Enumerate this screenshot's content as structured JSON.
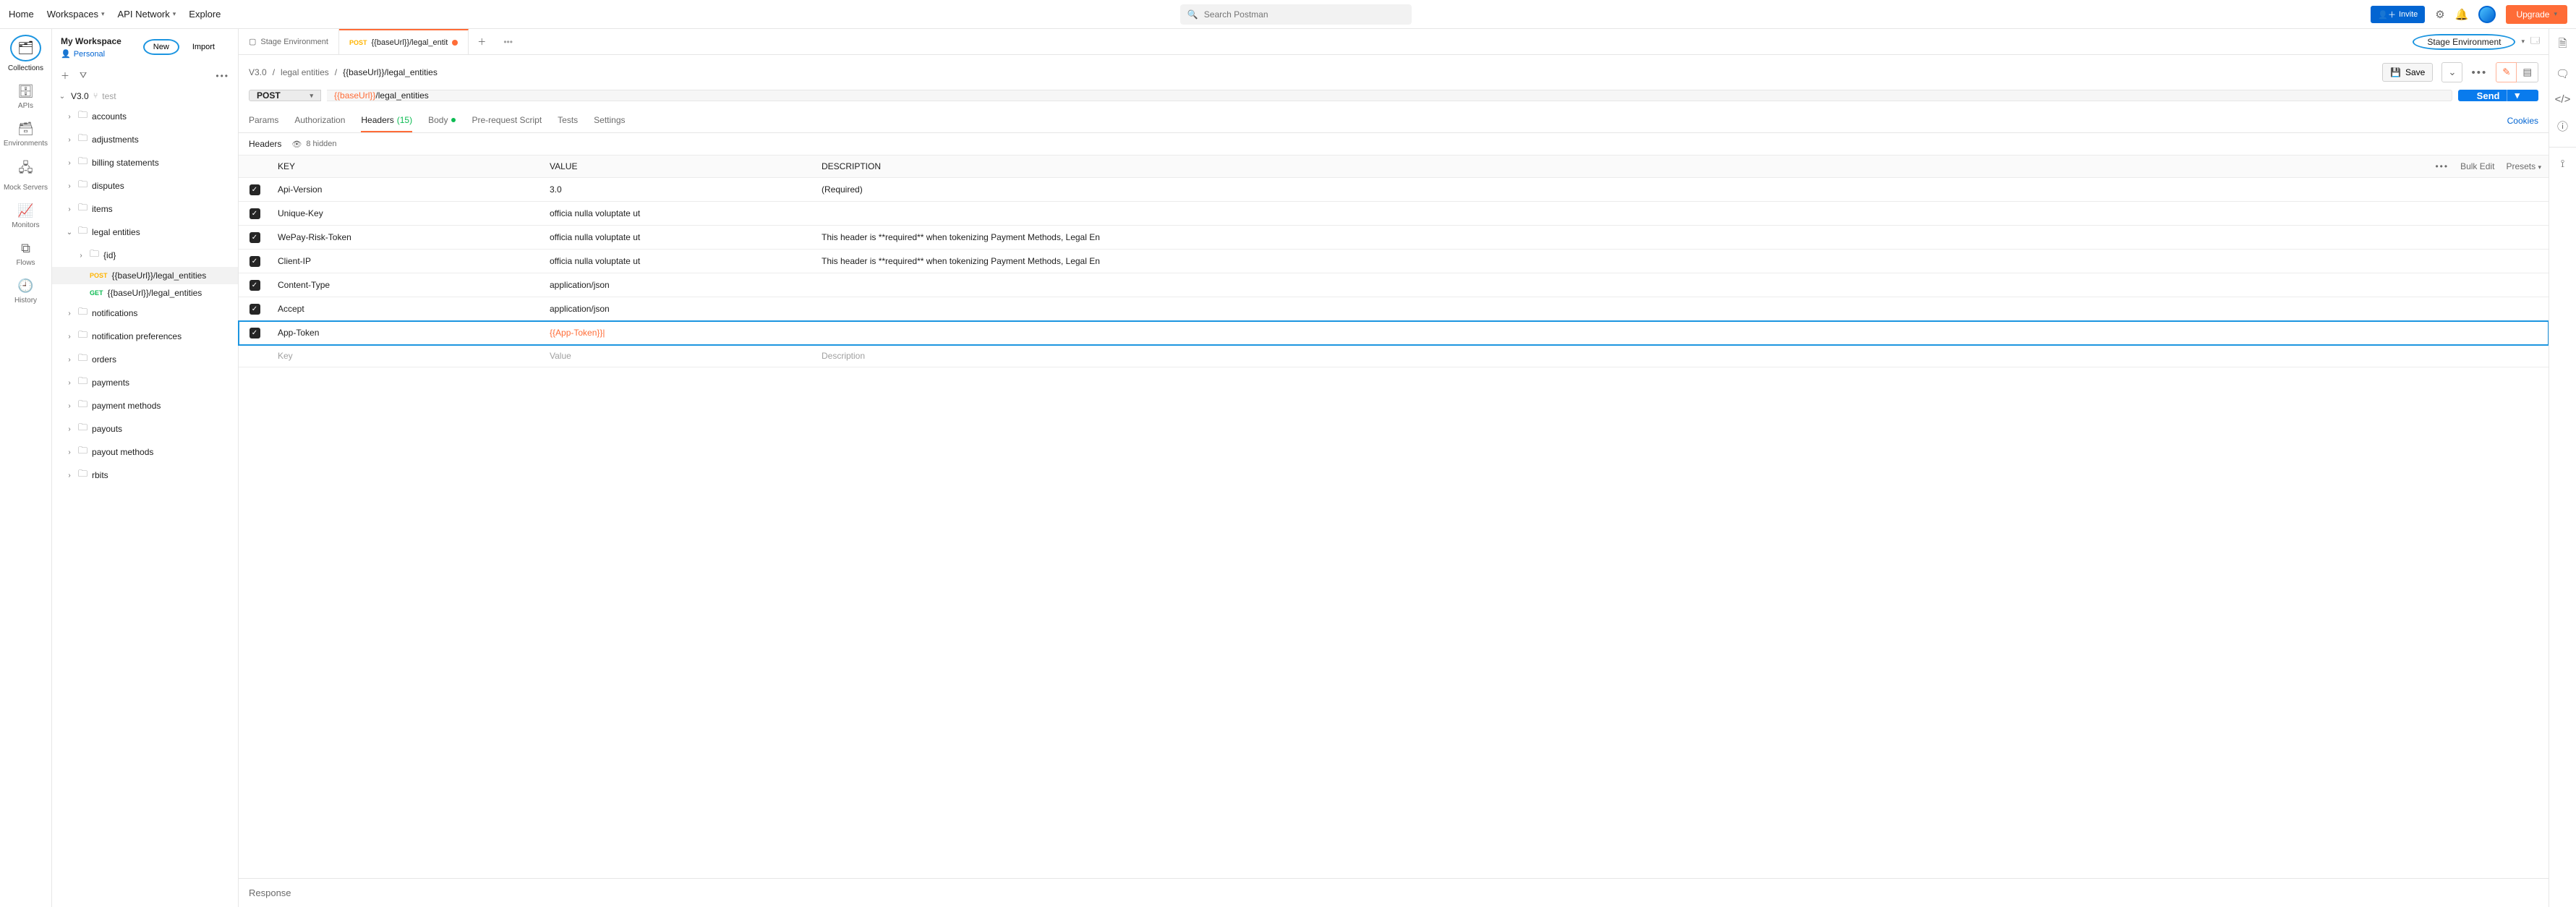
{
  "topnav": {
    "home": "Home",
    "workspaces": "Workspaces",
    "api_network": "API Network",
    "explore": "Explore",
    "search_placeholder": "Search Postman",
    "invite": "Invite",
    "upgrade": "Upgrade"
  },
  "workspace": {
    "title": "My Workspace",
    "visibility": "Personal",
    "new_btn": "New",
    "import_btn": "Import"
  },
  "rail": {
    "collections": "Collections",
    "apis": "APIs",
    "environments": "Environments",
    "mock": "Mock Servers",
    "monitors": "Monitors",
    "flows": "Flows",
    "history": "History"
  },
  "tree": {
    "root": "V3.0",
    "root_tag": "test",
    "folders": [
      "accounts",
      "adjustments",
      "billing statements",
      "disputes",
      "items"
    ],
    "legal": {
      "name": "legal entities",
      "id_folder": "{id}",
      "post": "{{baseUrl}}/legal_entities",
      "get": "{{baseUrl}}/legal_entities"
    },
    "folders2": [
      "notifications",
      "notification preferences",
      "orders",
      "payments",
      "payment methods",
      "payouts",
      "payout methods",
      "rbits"
    ]
  },
  "tabs": {
    "t1": "Stage Environment",
    "t2_method": "POST",
    "t2_label": "{{baseUrl}}/legal_entit"
  },
  "env": {
    "selected": "Stage Environment"
  },
  "crumb": {
    "c1": "V3.0",
    "c2": "legal entities",
    "c3": "{{baseUrl}}/legal_entities",
    "save": "Save"
  },
  "request": {
    "method": "POST",
    "url_var": "{{baseUrl}}",
    "url_path": "/legal_entities",
    "send": "Send"
  },
  "subtabs": {
    "params": "Params",
    "auth": "Authorization",
    "headers": "Headers",
    "headers_count": "(15)",
    "body": "Body",
    "prereq": "Pre-request Script",
    "tests": "Tests",
    "settings": "Settings",
    "cookies": "Cookies"
  },
  "headers_section": {
    "label": "Headers",
    "hidden": "8 hidden"
  },
  "table": {
    "head": {
      "key": "KEY",
      "value": "VALUE",
      "desc": "DESCRIPTION",
      "bulk": "Bulk Edit",
      "presets": "Presets"
    },
    "rows": [
      {
        "key": "Api-Version",
        "value": "3.0",
        "desc": "(Required)"
      },
      {
        "key": "Unique-Key",
        "value": "officia nulla voluptate ut",
        "desc": ""
      },
      {
        "key": "WePay-Risk-Token",
        "value": "officia nulla voluptate ut",
        "desc": "This header is **required** when tokenizing Payment Methods, Legal En"
      },
      {
        "key": "Client-IP",
        "value": "officia nulla voluptate ut",
        "desc": "This header is **required** when tokenizing Payment Methods, Legal En"
      },
      {
        "key": "Content-Type",
        "value": "application/json",
        "desc": ""
      },
      {
        "key": "Accept",
        "value": "application/json",
        "desc": ""
      }
    ],
    "highlight": {
      "key": "App-Token",
      "value": "{{App-Token}}|",
      "desc": ""
    },
    "placeholder": {
      "key": "Key",
      "value": "Value",
      "desc": "Description"
    }
  },
  "response": {
    "label": "Response"
  }
}
